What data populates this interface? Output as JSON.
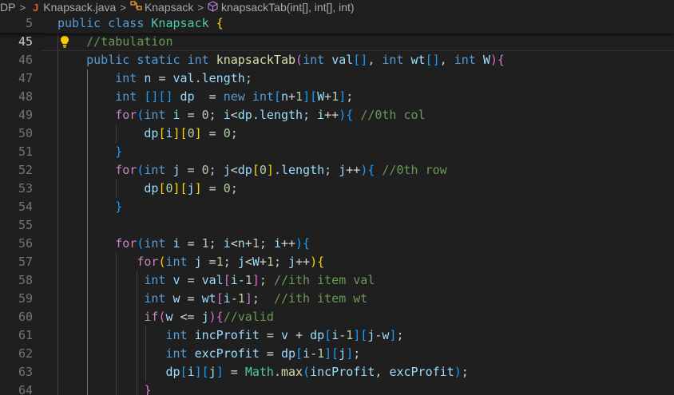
{
  "breadcrumb": {
    "folder": "DP",
    "file": "Knapsack.java",
    "file_icon": "J",
    "class_name": "Knapsack",
    "method": "knapsackTab(int[], int[], int)",
    "separator": ">"
  },
  "colors": {
    "background": "#1f1f1f",
    "keyword": "#569cd6",
    "control": "#c586c0",
    "class": "#4ec9b0",
    "function": "#dcdcaa",
    "variable": "#9cdcfe",
    "number": "#b5cea8",
    "comment": "#6a9955",
    "bracket_1": "#ffd700",
    "bracket_2": "#da70d6",
    "bracket_3": "#179fff",
    "lightbulb": "#ffcc00"
  },
  "editor": {
    "sticky_line": {
      "number": "5",
      "text": "public class Knapsack {"
    },
    "active_line": "45",
    "lines": [
      {
        "number": "45",
        "text": "    //tabulation"
      },
      {
        "number": "46",
        "text": "    public static int knapsackTab(int val[], int wt[], int W){"
      },
      {
        "number": "47",
        "text": "        int n = val.length;"
      },
      {
        "number": "48",
        "text": "        int [][] dp  = new int[n+1][W+1];"
      },
      {
        "number": "49",
        "text": "        for(int i = 0; i<dp.length; i++){ //0th col"
      },
      {
        "number": "50",
        "text": "            dp[i][0] = 0;"
      },
      {
        "number": "51",
        "text": "        }"
      },
      {
        "number": "52",
        "text": "        for(int j = 0; j<dp[0].length; j++){ //0th row"
      },
      {
        "number": "53",
        "text": "            dp[0][j] = 0;"
      },
      {
        "number": "54",
        "text": "        }"
      },
      {
        "number": "55",
        "text": ""
      },
      {
        "number": "56",
        "text": "        for(int i = 1; i<n+1; i++){"
      },
      {
        "number": "57",
        "text": "           for(int j =1; j<W+1; j++){"
      },
      {
        "number": "58",
        "text": "            int v = val[i-1]; //ith item val"
      },
      {
        "number": "59",
        "text": "            int w = wt[i-1];  //ith item wt"
      },
      {
        "number": "60",
        "text": "            if(w <= j){//valid"
      },
      {
        "number": "61",
        "text": "               int incProfit = v + dp[i-1][j-w];"
      },
      {
        "number": "62",
        "text": "               int excProfit = dp[i-1][j];"
      },
      {
        "number": "63",
        "text": "               dp[i][j] = Math.max(incProfit, excProfit);"
      },
      {
        "number": "64",
        "text": "            }"
      }
    ]
  }
}
